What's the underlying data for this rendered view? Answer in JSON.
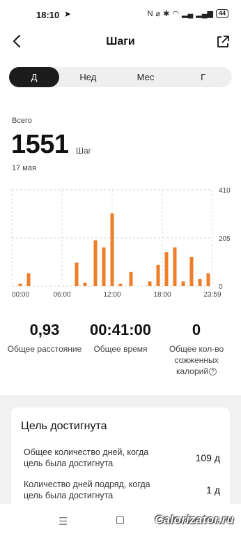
{
  "status": {
    "time": "18:10",
    "battery": "44"
  },
  "header": {
    "title": "Шаги"
  },
  "tabs": [
    {
      "label": "Д",
      "active": true
    },
    {
      "label": "Нед",
      "active": false
    },
    {
      "label": "Мес",
      "active": false
    },
    {
      "label": "Г",
      "active": false
    }
  ],
  "summary": {
    "label": "Всего",
    "value": "1551",
    "unit": "Шаг",
    "date": "17 мая"
  },
  "chart_data": {
    "type": "bar",
    "color": "#f07d28",
    "x_ticks": [
      "00:00",
      "06:00",
      "12:00",
      "18:00",
      "23:59"
    ],
    "y_ticks": [
      "410",
      "205",
      "0"
    ],
    "ylim": [
      0,
      410
    ],
    "x_range_hours": [
      0,
      24
    ],
    "bars": [
      {
        "hour": 1.0,
        "value": 10
      },
      {
        "hour": 2.0,
        "value": 55
      },
      {
        "hour": 7.75,
        "value": 100
      },
      {
        "hour": 8.75,
        "value": 15
      },
      {
        "hour": 10.0,
        "value": 195
      },
      {
        "hour": 11.0,
        "value": 165
      },
      {
        "hour": 12.0,
        "value": 310
      },
      {
        "hour": 13.0,
        "value": 10
      },
      {
        "hour": 14.25,
        "value": 60
      },
      {
        "hour": 16.5,
        "value": 20
      },
      {
        "hour": 17.5,
        "value": 90
      },
      {
        "hour": 18.5,
        "value": 145
      },
      {
        "hour": 19.5,
        "value": 165
      },
      {
        "hour": 20.5,
        "value": 20
      },
      {
        "hour": 21.5,
        "value": 125
      },
      {
        "hour": 22.5,
        "value": 30
      },
      {
        "hour": 23.5,
        "value": 55
      }
    ]
  },
  "stats": {
    "distance": {
      "value": "0,93",
      "label": "Общее расстояние"
    },
    "time": {
      "value": "00:41:00",
      "label": "Общее время"
    },
    "calories": {
      "value": "0",
      "label_line1": "Общее кол-во",
      "label_line2": "сожженных",
      "label_line3": "калорий"
    }
  },
  "goal": {
    "title": "Цель достигнута",
    "total_days": {
      "label_line1": "Общее количество дней, когда",
      "label_line2": "цель была достигнута",
      "value": "109 д"
    },
    "streak_days": {
      "label_line1": "Количество дней подряд, когда",
      "label_line2": "цель была достигнута",
      "value": "1 д"
    }
  },
  "watermark": "Calorizator.ru"
}
